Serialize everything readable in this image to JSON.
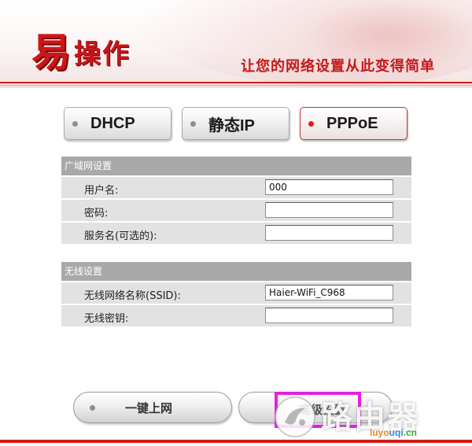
{
  "header": {
    "logo_main": "易",
    "logo_rest": "操作",
    "slogan": "让您的网络设置从此变得简单"
  },
  "modes": [
    {
      "label": "DHCP",
      "active": false
    },
    {
      "label": "静态IP",
      "active": false
    },
    {
      "label": "PPPoE",
      "active": true
    }
  ],
  "wan": {
    "title": "广域网设置",
    "username_label": "用户名:",
    "username_value": "000",
    "password_label": "密码:",
    "password_value": "",
    "service_label": "服务名(可选的):",
    "service_value": ""
  },
  "wireless": {
    "title": "无线设置",
    "ssid_label": "无线网络名称(SSID):",
    "ssid_value": "Haier-WiFi_C968",
    "key_label": "无线密钥:",
    "key_value": ""
  },
  "bottom": {
    "connect_label": "一键上网",
    "advanced_label": "高级设置"
  },
  "watermark": {
    "text": "路由器",
    "site_parts": [
      "luyo",
      "uqi",
      ".cn"
    ]
  },
  "colors": {
    "brand_red": "#d01517",
    "section_gray": "#a9a9a9",
    "highlight": "#e51fe0"
  }
}
